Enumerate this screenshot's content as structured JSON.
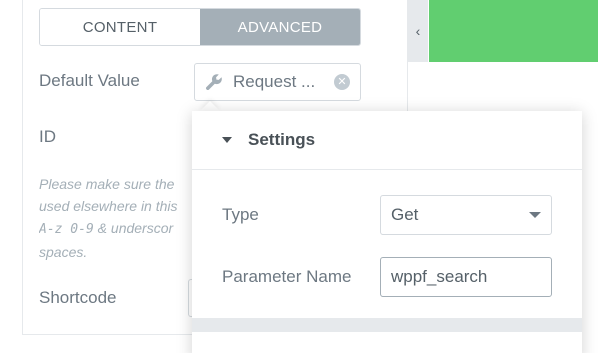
{
  "tabs": {
    "content_label": "CONTENT",
    "advanced_label": "ADVANCED"
  },
  "controls": {
    "default_value_label": "Default Value",
    "default_value_text": "Request ...",
    "id_label": "ID",
    "help_line1": "Please make sure the",
    "help_line2": "used elsewhere in this",
    "help_line3_code": "A-z 0-9",
    "help_line3_rest": " & underscor",
    "help_line4": "spaces.",
    "shortcode_label": "Shortcode"
  },
  "preview": {
    "collapse_glyph": "‹",
    "accent_color": "#61ce70"
  },
  "popover": {
    "title": "Settings",
    "type_label": "Type",
    "type_value": "Get",
    "param_label": "Parameter Name",
    "param_value": "wppf_search"
  },
  "icons": [
    "wrench-icon",
    "clear-icon",
    "caret-down-icon",
    "chevron-left-icon",
    "select-caret-icon"
  ]
}
